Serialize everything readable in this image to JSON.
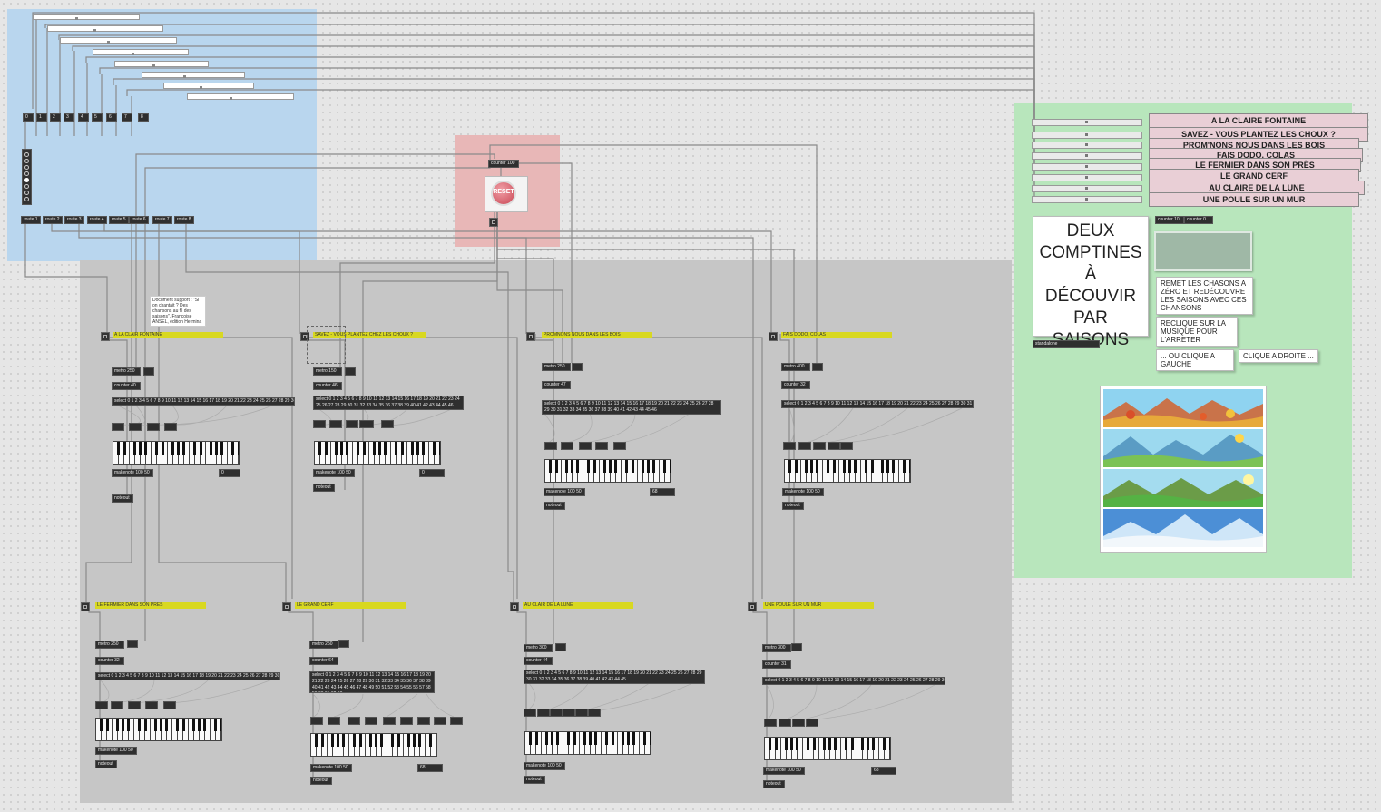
{
  "songs": [
    "A LA CLAIRE FONTAINE",
    "SAVEZ - VOUS PLANTEZ LES CHOUX ?",
    "PROM'NONS NOUS DANS LES BOIS",
    "FAIS DODO, COLAS",
    "LE FERMIER DANS SON PRÈS",
    "LE GRAND CERF",
    "AU CLAIRE DE LA LUNE",
    "UNE POULE SUR UN MUR"
  ],
  "numbers": [
    "0",
    "1",
    "2",
    "3",
    "4",
    "5",
    "6",
    "7",
    "8"
  ],
  "routes": [
    "route 1",
    "route 2",
    "route 3",
    "route 4",
    "route 5",
    "route 6",
    "route 7",
    "route 8"
  ],
  "reset": {
    "counter": "counter 100",
    "label": "RESET"
  },
  "title_card": "DEUX COMPTINES À DÉCOUVIR PAR SAISONS",
  "standalone": "standalone",
  "pill_buttons": {
    "a": "counter 10",
    "b": "counter 0"
  },
  "notes": {
    "reset_note": "REMET LES CHASONS A ZÉRO ET REDÉCOUVRE LES SAISONS AVEC CES CHANSONS",
    "reclick_note": "RECLIQUE SUR LA MUSIQUE POUR L'ARRETER",
    "left_note": "... OU CLIQUE A GAUCHE",
    "right_note": "CLIQUE A DROITE ..."
  },
  "document_comment": "Document support : \"Si on chantait ? Des chansons au fil des saisons\", Françoise ANSEL, édition Hermina",
  "modules": [
    {
      "label": "A LA CLAIR FONTAINE",
      "metro": "metro 250",
      "counter": "counter 40",
      "select": "select 0 1 2 3 4 5 6 7 8 9 10 11 12 13 14 15 16 17 18 19 20 21 22 23 24 25 26 27 28 29 30 31 32 33",
      "makenote": "makenote 100 50",
      "noteout": "noteout",
      "num": "0"
    },
    {
      "label": "SAVEZ - VOUS PLANTEZ CHEZ LES CHOUX ?",
      "metro": "metro 150",
      "counter": "counter 46",
      "select": "select 0 1 2 3 4 5 6 7 8 9 10 11 12 13 14 15 16 17 18 19 20 21 22 23 24 25 26 27 28 29 30 31 32 33 34 35 36 37 38 39 40 41 42 43 44 45 46",
      "makenote": "makenote 100 50",
      "noteout": "noteout",
      "num": "0"
    },
    {
      "label": "PROMNONS NOUS DANS LES BOIS",
      "metro": "metro 250",
      "counter": "counter 47",
      "select": "select 0 1 2 3 4 5 6 7 8 9 10 11 12 13 14 15 16 17 18 19 20 21 22 23 24 25 26 27 28 29 30 31 32 33 34 35 36 37 38 39 40 41 42 43 44 45 46",
      "makenote": "makenote 100 50",
      "noteout": "noteout",
      "num": "68"
    },
    {
      "label": "FAIS DODO, COLAS",
      "metro": "metro 400",
      "counter": "counter 32",
      "select": "select 0 1 2 3 4 5 6 7 8 9 10 11 12 13 14 15 16 17 18 19 20 21 22 23 24 25 26 27 28 29 30 31",
      "makenote": "makenote 100 50",
      "noteout": "noteout",
      "num": ""
    },
    {
      "label": "LE FERMIER DANS SON PRES",
      "metro": "metro 250",
      "counter": "counter 32",
      "select": "select 0 1 2 3 4 5 6 7 8 9 10 11 12 13 14 15 16 17 18 19 20 21 22 23 24 25 26 27 28 29 30 31 32",
      "makenote": "makenote 100 50",
      "noteout": "noteout",
      "num": ""
    },
    {
      "label": "LE GRAND CERF",
      "metro": "metro 250",
      "counter": "counter 64",
      "select": "select 0 1 2 3 4 5 6 7 8 9 10 11 12 13 14 15 16 17 18 19 20 21 22 23 24 25 26 27 28 29 30 31 32 33 34 35 36 37 38 39 40 41 42 43 44 45 46 47 48 49 50 51 52 53 54 55 56 57 58 59 60 61 62 63",
      "makenote": "makenote 100 50",
      "noteout": "noteout",
      "num": "68"
    },
    {
      "label": "AU CLAIR DE LA LUNE",
      "metro": "metro 300",
      "counter": "counter 44",
      "select": "select 0 1 2 3 4 5 6 7 8 9 10 11 12 13 14 15 16 17 18 19 20 21 22 23 24 25 26 27 28 29 30 31 32 33 34 35 36 37 38 39 40 41 42 43 44 45",
      "makenote": "makenote 100 50",
      "noteout": "noteout",
      "num": ""
    },
    {
      "label": "UNE POULE SUR UN MUR",
      "metro": "metro 300",
      "counter": "counter 31",
      "select": "select 0 1 2 3 4 5 6 7 8 9 10 11 12 13 14 15 16 17 18 19 20 21 22 23 24 25 26 27 28 29 30 31",
      "makenote": "makenote 100 50",
      "noteout": "noteout",
      "num": "68"
    }
  ],
  "colors": {
    "blue_panel": "#b9d6ee",
    "red_panel": "#e8b7b7",
    "green_panel": "#b8e6bc",
    "gray_panel": "#c6c6c6",
    "label_yellow": "#d8d821"
  }
}
